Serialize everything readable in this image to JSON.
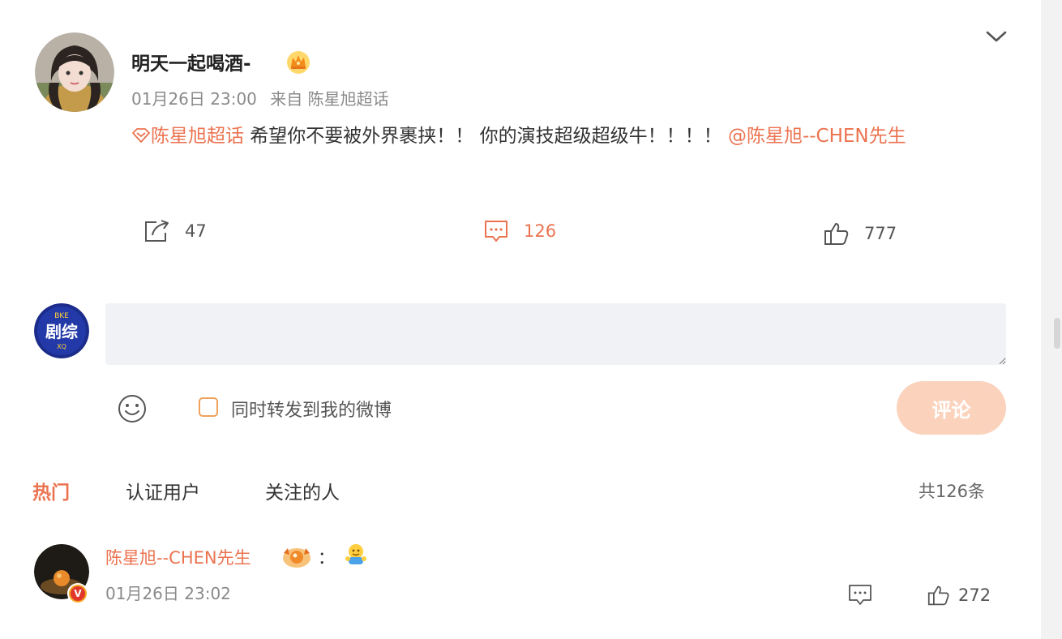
{
  "post": {
    "username": "明天一起喝酒-",
    "date": "01月26日 23:00",
    "source": "来自 陈星旭超话",
    "topic_link": "陈星旭超话",
    "body_text": " 希望你不要被外界裹挟！！ 你的演技超级超级牛！！！！ ",
    "mention_link": "@陈星旭--CHEN先生",
    "icons": {
      "badge": "crown-icon",
      "menu": "chevron-down-icon",
      "topic": "supertopic-icon"
    }
  },
  "actions": {
    "repost_count": "47",
    "comment_count": "126",
    "like_count": "777"
  },
  "composer": {
    "input_value": "",
    "repost_label": "同时转发到我的微博",
    "submit_label": "评论",
    "avatar_text": {
      "line1": "BKE",
      "line2": "剧综",
      "line3": "XQ"
    }
  },
  "tabs": {
    "hot": "热门",
    "verified": "认证用户",
    "following": "关注的人",
    "total": "共126条"
  },
  "comments": [
    {
      "name": "陈星旭--CHEN先生",
      "colon": "：",
      "time": "01月26日 23:02",
      "like_count": "272",
      "badge_text": "V"
    }
  ],
  "colors": {
    "accent": "#eb7350",
    "submit_bg": "#fbd3bd",
    "input_bg": "#f1f2f5",
    "checkbox_border": "#f0a15b"
  }
}
